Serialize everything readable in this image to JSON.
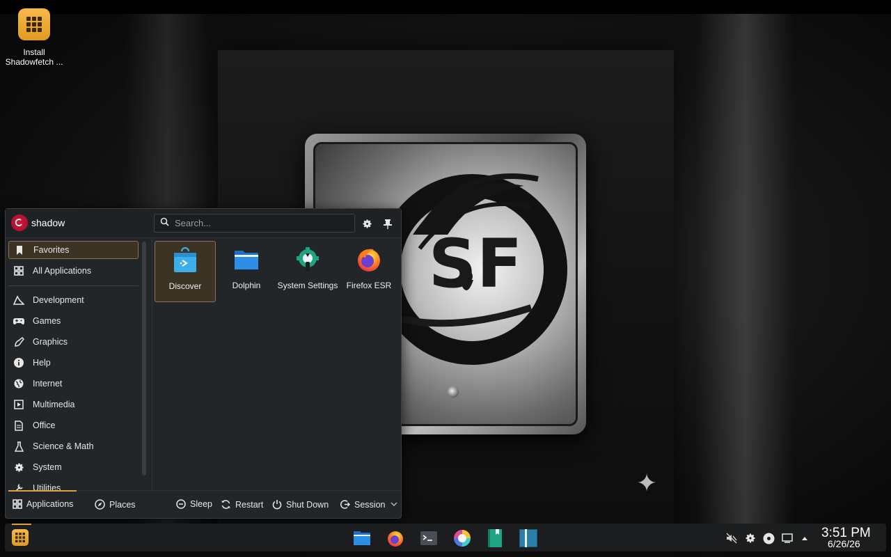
{
  "desktop": {
    "icon_label": "Install Shadowfetch ...",
    "icon": "grid-icon"
  },
  "launcher": {
    "user": {
      "name": "shadow",
      "avatar_icon": "debian-swirl-icon"
    },
    "search": {
      "placeholder": "Search...",
      "value": ""
    },
    "header_buttons": [
      {
        "name": "configure",
        "icon": "gear-icon"
      },
      {
        "name": "pin",
        "icon": "pin-icon"
      }
    ],
    "sidebar": {
      "items": [
        {
          "label": "Favorites",
          "icon": "bookmark-icon",
          "active": true
        },
        {
          "label": "All Applications",
          "icon": "apps-grid-icon"
        },
        {
          "label": "Development",
          "icon": "development-icon"
        },
        {
          "label": "Games",
          "icon": "gamepad-icon"
        },
        {
          "label": "Graphics",
          "icon": "graphics-icon"
        },
        {
          "label": "Help",
          "icon": "info-icon"
        },
        {
          "label": "Internet",
          "icon": "globe-icon"
        },
        {
          "label": "Multimedia",
          "icon": "multimedia-icon"
        },
        {
          "label": "Office",
          "icon": "office-icon"
        },
        {
          "label": "Science & Math",
          "icon": "flask-icon"
        },
        {
          "label": "System",
          "icon": "system-gear-icon"
        },
        {
          "label": "Utilities",
          "icon": "utilities-icon"
        }
      ]
    },
    "favorites": [
      {
        "label": "Discover",
        "icon": "discover-icon",
        "active": true
      },
      {
        "label": "Dolphin",
        "icon": "folder-icon"
      },
      {
        "label": "System Settings",
        "icon": "system-settings-icon"
      },
      {
        "label": "Firefox ESR",
        "icon": "firefox-icon"
      }
    ],
    "footer": {
      "applications": "Applications",
      "places": "Places",
      "sleep": "Sleep",
      "restart": "Restart",
      "shutdown": "Shut Down",
      "session": "Session"
    }
  },
  "taskbar": {
    "apps": [
      {
        "name": "dolphin",
        "icon": "folder-icon"
      },
      {
        "name": "firefox",
        "icon": "firefox-icon"
      },
      {
        "name": "terminal",
        "icon": "terminal-icon"
      },
      {
        "name": "color-app",
        "icon": "color-wheel-icon"
      },
      {
        "name": "book-green",
        "icon": "book-icon"
      },
      {
        "name": "book-blue",
        "icon": "book-icon"
      }
    ],
    "tray": [
      {
        "name": "volume-muted",
        "icon": "volume-muted-icon"
      },
      {
        "name": "settings",
        "icon": "gear-icon"
      },
      {
        "name": "media",
        "icon": "disc-icon"
      },
      {
        "name": "display",
        "icon": "monitor-icon"
      },
      {
        "name": "expand",
        "icon": "caret-up-icon"
      }
    ],
    "clock": {
      "time": "3:51 PM",
      "date": "6/26/26"
    }
  },
  "colors": {
    "accent": "#e0a040",
    "panel_bg": "#232629",
    "taskbar_bg": "#1b1d1f",
    "selection_bg": "#3b3425"
  }
}
